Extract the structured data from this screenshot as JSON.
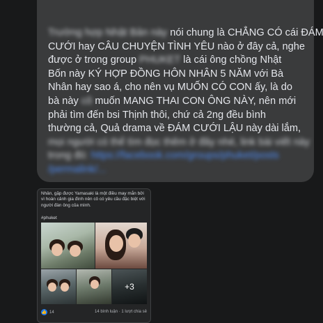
{
  "message": {
    "lines": [
      {
        "blurred": "Trường hợp Nhật Bản này",
        "text": " nói chung là CHẲNG CÓ cái ĐÁM"
      },
      {
        "text": "CƯỚI hay CÂU CHUYỆN TÌNH YÊU nào ở đây cả, nghe"
      },
      {
        "text": "được ở trong group ",
        "blurred": "PHUKET",
        "text2": " là cái ông chồng Nhật"
      },
      {
        "text": "Bốn này KÝ HỢP ĐỒNG HÔN NHÂN 5 NĂM với Bà"
      },
      {
        "text": "Nhân hay sao á, cho nên vụ MUỐN CÓ CON ấy, là do"
      },
      {
        "text": "bà này ",
        "blurred": "cô",
        "text2": " muốn MANG THAI CON ÔNG NÀY, nên mới"
      },
      {
        "text": "phải tìm đến bsi Thịnh thôi, chứ cả 2ng đều bình"
      },
      {
        "text": "thường cả, Quả drama về ĐÁM CƯỚI LẬU này dài lắm,"
      },
      {
        "blurred": "mọi người có thể tìm đọc thêm ở đây nhé, link bài viết này"
      },
      {
        "blurred": "trong đó: ",
        "link": "https://facebook.com/groups/phuket/posts"
      },
      {
        "link": "/permalink/..."
      }
    ]
  },
  "post": {
    "text": "Nhân, gặp được Yamasaki là một điều may mắn bởi vì hoàn cảnh gia đình nên cô có yêu cầu đặc biệt với người đàn ông của mình.",
    "hashtag": "#phuket",
    "more_photos": "+3",
    "reaction_count": "14",
    "stats": "14 bình luận · 1 lượt chia sẻ"
  },
  "colors": {
    "background": "#18191a",
    "bubble": "#3a3b3c",
    "text": "#e4e6eb",
    "link": "#4e8cf5"
  },
  "icons": [
    "like-icon"
  ]
}
